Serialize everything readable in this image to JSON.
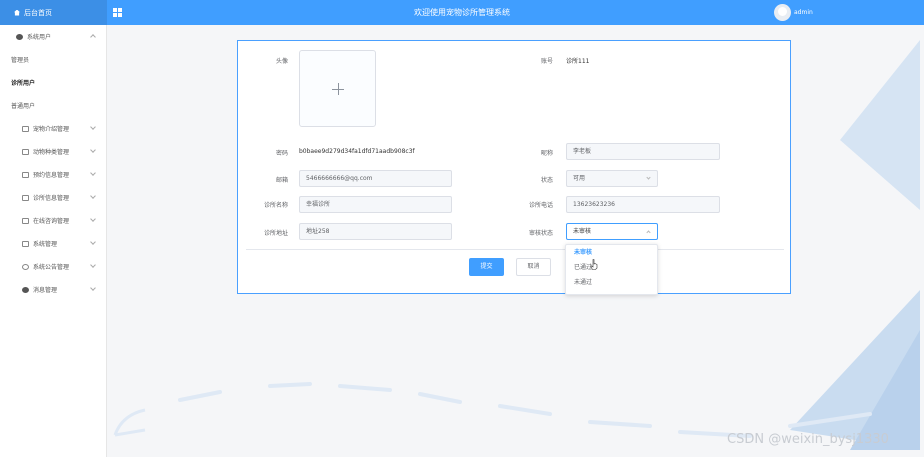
{
  "header": {
    "brand_label": "后台首页",
    "title": "欢迎使用宠物诊所管理系统",
    "username": "admin"
  },
  "sidebar": {
    "group_open": {
      "label": "系统用户",
      "icon": "user-icon"
    },
    "sub_items": [
      {
        "label": "管理员",
        "active": false
      },
      {
        "label": "诊所用户",
        "active": true
      },
      {
        "label": "普通用户",
        "active": false
      }
    ],
    "items": [
      {
        "label": "宠物介绍管理",
        "icon": "folder-icon"
      },
      {
        "label": "动物种类管理",
        "icon": "folder-icon"
      },
      {
        "label": "预约信息管理",
        "icon": "folder-icon"
      },
      {
        "label": "诊所信息管理",
        "icon": "folder-icon"
      },
      {
        "label": "在线咨询管理",
        "icon": "folder-icon"
      },
      {
        "label": "系统管理",
        "icon": "settings-icon"
      },
      {
        "label": "系统公告管理",
        "icon": "clock-icon"
      },
      {
        "label": "消息管理",
        "icon": "location-icon"
      }
    ]
  },
  "form": {
    "avatar_label": "头像",
    "account_label": "账号",
    "account_value": "诊所111",
    "password_label": "密码",
    "password_value": "b0baee9d279d34fa1dfd71aadb908c3f",
    "nickname_label": "昵称",
    "nickname_value": "李老板",
    "email_label": "邮箱",
    "email_value": "5466666666@qq.com",
    "status_label": "状态",
    "status_value": "可用",
    "clinic_name_label": "诊所名称",
    "clinic_name_value": "幸福诊所",
    "clinic_phone_label": "诊所电话",
    "clinic_phone_value": "13623623236",
    "clinic_address_label": "诊所地址",
    "clinic_address_value": "地址258",
    "review_status_label": "审核状态",
    "review_status_value": "未审核",
    "submit_label": "提交",
    "cancel_label": "取消"
  },
  "review_dropdown": {
    "options": [
      "未审核",
      "已通过",
      "未通过"
    ],
    "selected": "未审核"
  },
  "watermark": "CSDN @weixin_bysj1330",
  "colors": {
    "primary": "#409eff",
    "topbar": "#409eff"
  }
}
